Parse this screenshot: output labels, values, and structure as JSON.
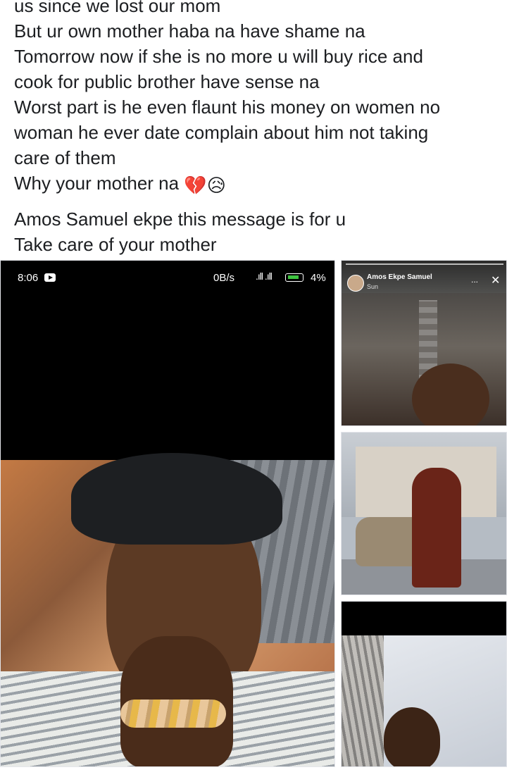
{
  "post": {
    "lines_top": [
      "us since we lost our mom",
      "But ur own mother haba na have shame na",
      "Tomorrow now if she is no more u will buy rice and",
      "cook for public brother have sense na",
      "Worst part is he even flaunt his money on women no",
      "woman he ever date complain about him not taking",
      "care of them",
      "Why your mother na"
    ],
    "emojis": [
      "💔",
      "😥"
    ],
    "lines_bottom": [
      "Amos Samuel ekpe this message is for u",
      "Take care of your mother"
    ]
  },
  "photos": {
    "main": {
      "status_time": "8:06",
      "status_net": "0B/s",
      "status_battery": "4%",
      "status_signal": ".ıll .ıll"
    },
    "story": {
      "name": "Amos Ekpe Samuel",
      "time": "Sun",
      "menu_glyph": "...",
      "close_glyph": "✕"
    }
  }
}
